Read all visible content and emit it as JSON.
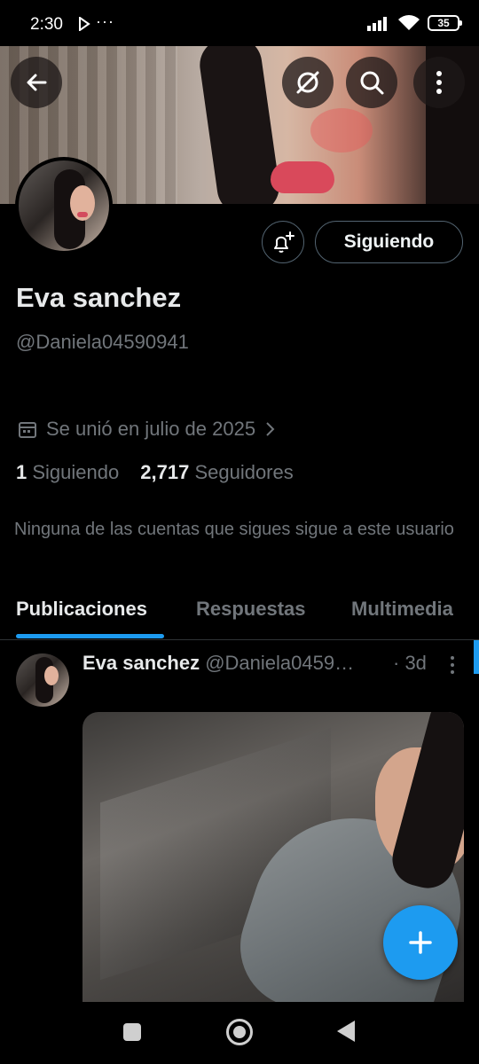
{
  "status_bar": {
    "time": "2:30",
    "dots": "···",
    "battery": "35"
  },
  "profile": {
    "name": "Eva sanchez",
    "handle": "@Daniela04590941",
    "joined": "Se unió en julio de 2025",
    "following_count": "1",
    "following_label": "Siguiendo",
    "followers_count": "2,717",
    "followers_label": "Seguidores",
    "mutual_text": "Ninguna de las cuentas que sigues sigue a este usuario",
    "follow_button_label": "Siguiendo"
  },
  "header_icons": [
    "back-arrow-icon",
    "ai-slash-icon",
    "search-icon",
    "more-vertical-icon"
  ],
  "tabs": [
    {
      "label": "Publicaciones",
      "active": true
    },
    {
      "label": "Respuestas",
      "active": false
    },
    {
      "label": "Multimedia",
      "active": false
    }
  ],
  "post": {
    "author_name": "Eva sanchez",
    "author_handle": "@Daniela0459…",
    "time": "· 3d"
  },
  "colors": {
    "accent": "#1d9bf0",
    "muted": "#71767b",
    "background": "#000000"
  }
}
